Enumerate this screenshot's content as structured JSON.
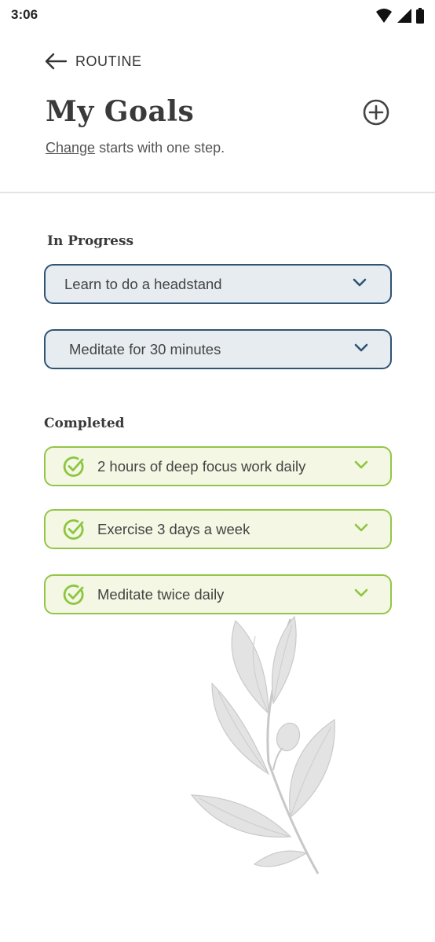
{
  "status_bar": {
    "time": "3:06"
  },
  "header": {
    "back_label": "ROUTINE"
  },
  "page": {
    "title": "My Goals",
    "subtitle_link": "Change",
    "subtitle_rest": " starts with one step."
  },
  "in_progress": {
    "label": "In Progress",
    "items": [
      {
        "text": "Learn to do a headstand"
      },
      {
        "text": "Meditate for 30 minutes"
      }
    ]
  },
  "completed": {
    "label": "Completed",
    "items": [
      {
        "text": "2 hours of deep focus work daily"
      },
      {
        "text": "Exercise 3 days a week"
      },
      {
        "text": "Meditate twice daily"
      }
    ]
  },
  "colors": {
    "progress_border": "#2f5474",
    "progress_bg": "#e6ecef",
    "done_border": "#93c648",
    "done_bg": "#f3f7e3"
  }
}
